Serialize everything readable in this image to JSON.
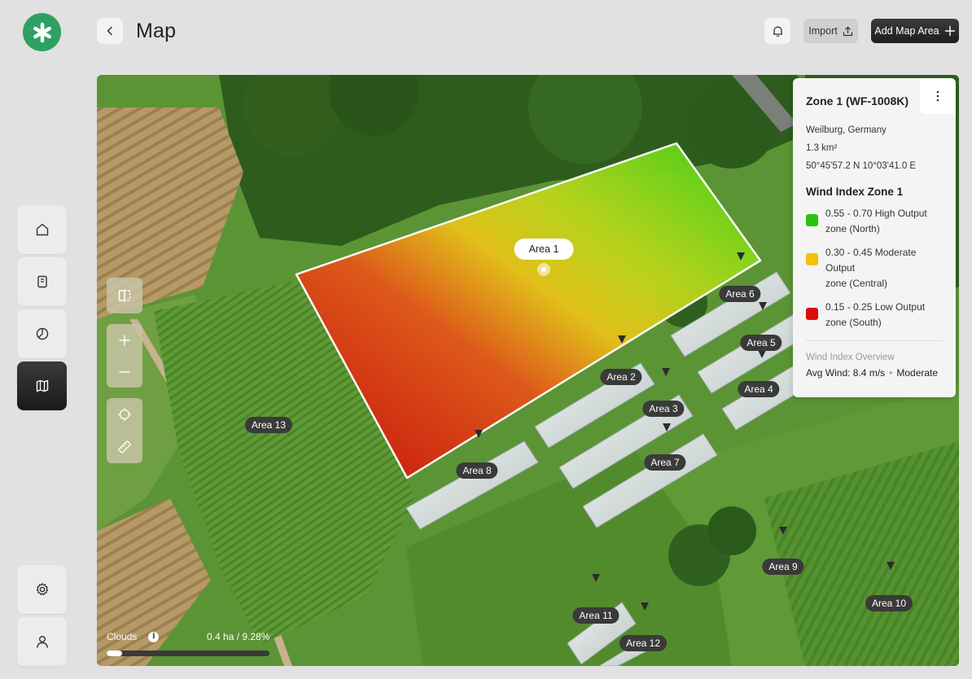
{
  "header": {
    "title": "Map",
    "import_label": "Import",
    "add_label": "Add Map Area"
  },
  "sidebar": {
    "items": [
      {
        "name": "home"
      },
      {
        "name": "reports"
      },
      {
        "name": "analytics"
      },
      {
        "name": "map",
        "active": true
      },
      {
        "name": "settings"
      },
      {
        "name": "profile"
      }
    ]
  },
  "map": {
    "areas": [
      "Area 1",
      "Area 2",
      "Area 3",
      "Area 4",
      "Area 5",
      "Area 6",
      "Area 7",
      "Area 8",
      "Area 9",
      "Area 10",
      "Area 11",
      "Area 12",
      "Area 13"
    ],
    "clouds": {
      "label": "Clouds",
      "value": "0.4 ha / 9.28%",
      "percent": 9.28
    }
  },
  "panel": {
    "zone_title": "Zone 1 (WF-1008K)",
    "location": "Weilburg, Germany",
    "size": "1.3 km²",
    "coords": "50°45'57.2 N 10°03'41.0 E",
    "wind_title": "Wind Index Zone 1",
    "legend": [
      {
        "text_1": "0.55 - 0.70 High Output",
        "text_2": "zone (North)",
        "color": "#2bc20e"
      },
      {
        "text_1": "0.30 - 0.45 Moderate Output",
        "text_2": "zone (Central)",
        "color": "#f2c10a"
      },
      {
        "text_1": "0.15 - 0.25 Low Output",
        "text_2": "zone (South)",
        "color": "#d90d0d"
      }
    ],
    "overview_title": "Wind Index Overview",
    "avg_wind": "Avg Wind: 8.4 m/s",
    "status": "Moderate"
  },
  "colors": {
    "brand": "#2fa063",
    "high": "#2bc20e",
    "moderate": "#f2c10a",
    "low": "#d90d0d"
  }
}
